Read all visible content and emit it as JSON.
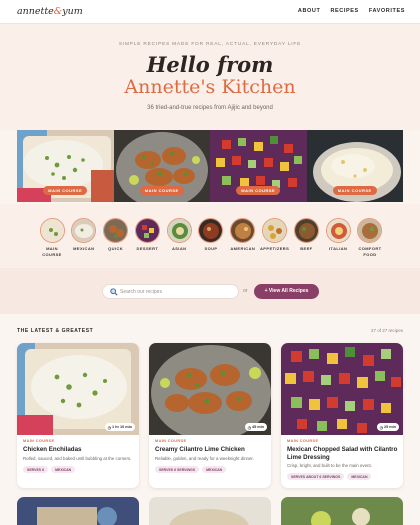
{
  "header": {
    "logo_left": "annette",
    "logo_amp": "&",
    "logo_right": "yum",
    "nav": [
      "ABOUT",
      "RECIPES",
      "FAVORITES"
    ]
  },
  "hero": {
    "kicker": "SIMPLE RECIPES MADE FOR REAL, ACTUAL, EVERYDAY LIFE",
    "title_line1": "Hello from",
    "title_line2": "Annette's Kitchen",
    "subtitle": "36 tried-and-true recipes from Ajijic and beyond"
  },
  "featured": [
    {
      "tag": "MAIN COURSE",
      "icon": "enchiladas-photo"
    },
    {
      "tag": "MAIN COURSE",
      "icon": "cilantro-chicken-photo"
    },
    {
      "tag": "MAIN COURSE",
      "icon": "chopped-salad-photo"
    },
    {
      "tag": "MAIN COURSE",
      "icon": "cheese-dish-photo"
    }
  ],
  "categories": [
    {
      "label": "MAIN COURSE"
    },
    {
      "label": "MEXICAN"
    },
    {
      "label": "QUICK"
    },
    {
      "label": "DESSERT"
    },
    {
      "label": "ASIAN"
    },
    {
      "label": "SOUP"
    },
    {
      "label": "AMERICAN"
    },
    {
      "label": "APPETIZERS"
    },
    {
      "label": "BEEF"
    },
    {
      "label": "ITALIAN"
    },
    {
      "label": "COMFORT FOOD"
    }
  ],
  "search": {
    "placeholder": "Search our recipes",
    "or": "or",
    "view_all": "+ View All Recipes",
    "icon": "search-icon"
  },
  "latest": {
    "title": "THE LATEST & GREATEST",
    "count": "27 of 27 recipes",
    "cards": [
      {
        "course": "MAIN COURSE",
        "title": "Chicken Enchiladas",
        "desc": "Rolled, sauced, and baked until bubbling at the corners.",
        "time": "1 hr 10 min",
        "tags": [
          "SERVES 6",
          "MEXICAN"
        ]
      },
      {
        "course": "MAIN COURSE",
        "title": "Creamy Cilantro Lime Chicken",
        "desc": "Reliable, golden, and ready for a weeknight dinner.",
        "time": "45 min",
        "tags": [
          "SERVES 6 SERVINGS",
          "MEXICAN"
        ]
      },
      {
        "course": "MAIN COURSE",
        "title": "Mexican Chopped Salad with Cilantro Lime Dressing",
        "desc": "Crisp, bright, and built to be the main event.",
        "time": "25 min",
        "tags": [
          "SERVES ABOUT 6 SERVINGS",
          "MEXICAN"
        ]
      }
    ]
  },
  "colors": {
    "accent": "#de6a43",
    "button": "#8a3f67",
    "background": "#fbf3ee"
  }
}
